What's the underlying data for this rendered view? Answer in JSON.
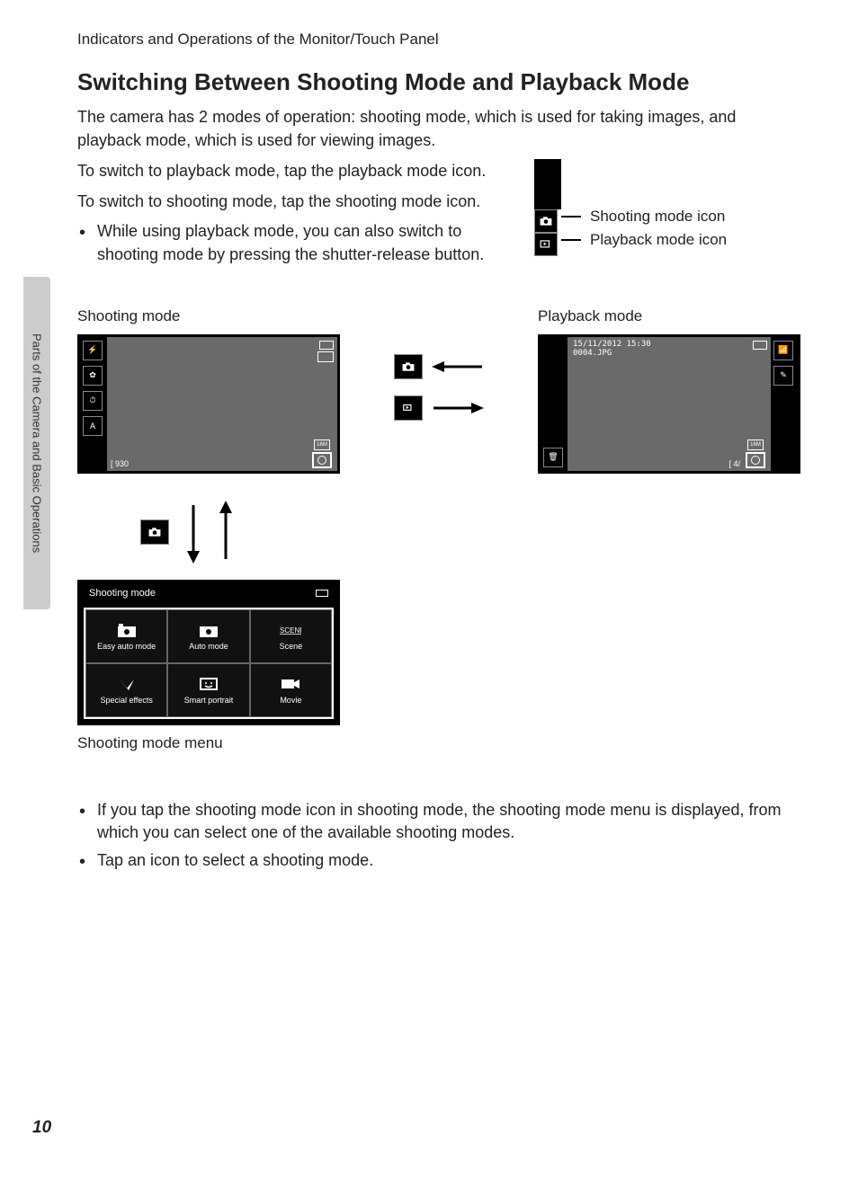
{
  "page_number": "10",
  "breadcrumb": "Indicators and Operations of the Monitor/Touch Panel",
  "side_tab": "Parts of the Camera and Basic Operations",
  "title": "Switching Between Shooting Mode and Playback Mode",
  "intro_para": "The camera has 2 modes of operation: shooting mode, which is used for taking images, and playback mode, which is used for viewing images.",
  "para2": "To switch to playback mode, tap the playback mode icon.",
  "para3": "To switch to shooting mode, tap the shooting mode icon.",
  "bullet1": "While using playback mode, you can also switch to shooting mode by pressing the shutter-release button.",
  "legend": {
    "shooting": "Shooting mode icon",
    "playback": "Playback mode icon"
  },
  "shooting_screen": {
    "label": "Shooting mode",
    "left_icons": [
      "flash-auto",
      "off1",
      "timer-off",
      "iso-auto"
    ],
    "counter": "[ 930",
    "chip": "16M"
  },
  "playback_screen": {
    "label": "Playback mode",
    "datetime": "15/11/2012 15:30",
    "filename": "0004.JPG",
    "right_icons": [
      "wifi-off",
      "rotate"
    ],
    "counter": "[    4/",
    "chip": "16M"
  },
  "menu": {
    "title": "Shooting mode",
    "caption": "Shooting mode menu",
    "cells": [
      "Easy auto mode",
      "Auto mode",
      "Scene",
      "Special effects",
      "Smart portrait",
      "Movie"
    ]
  },
  "bottom": {
    "b1": "If you tap the shooting mode icon in shooting mode, the shooting mode menu is displayed, from which you can select one of the available shooting modes.",
    "b2": "Tap an icon to select a shooting mode."
  }
}
